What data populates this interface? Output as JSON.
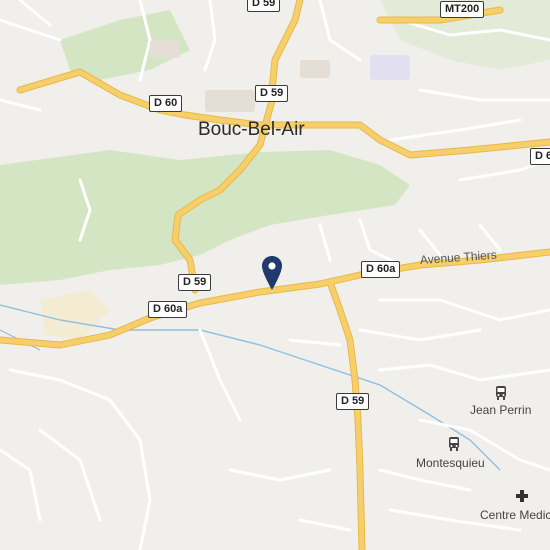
{
  "map": {
    "colors": {
      "background": "#f1efec",
      "green": "#d4e5c4",
      "major_road": "#f6cf6b",
      "major_road_edge": "#e8b84a",
      "minor_road": "#ffffff",
      "minor_road_edge": "#dcd7d0",
      "water": "#8cbfe0",
      "pin": "#1f3a6b"
    },
    "labels": {
      "town": "Bouc-Bel-Air",
      "street": "Avenue Thiers"
    },
    "road_shields": [
      {
        "name": "d59-top",
        "text": "D 59"
      },
      {
        "name": "mt200",
        "text": "MT200"
      },
      {
        "name": "d60",
        "text": "D 60"
      },
      {
        "name": "d59-center",
        "text": "D 59"
      },
      {
        "name": "d6-right",
        "text": "D 6"
      },
      {
        "name": "d60a-right",
        "text": "D 60a"
      },
      {
        "name": "d59-mid",
        "text": "D 59"
      },
      {
        "name": "d60a-left",
        "text": "D 60a"
      },
      {
        "name": "d59-south",
        "text": "D 59"
      }
    ],
    "pois": [
      {
        "name": "jean-perrin",
        "label": "Jean Perrin",
        "icon": "bus-stop-icon"
      },
      {
        "name": "montesquieu",
        "label": "Montesquieu",
        "icon": "bus-stop-icon"
      },
      {
        "name": "centre-medical",
        "label": "Centre Medic",
        "icon": "medical-cross-icon"
      }
    ],
    "marker": {
      "icon": "location-pin-icon"
    }
  }
}
